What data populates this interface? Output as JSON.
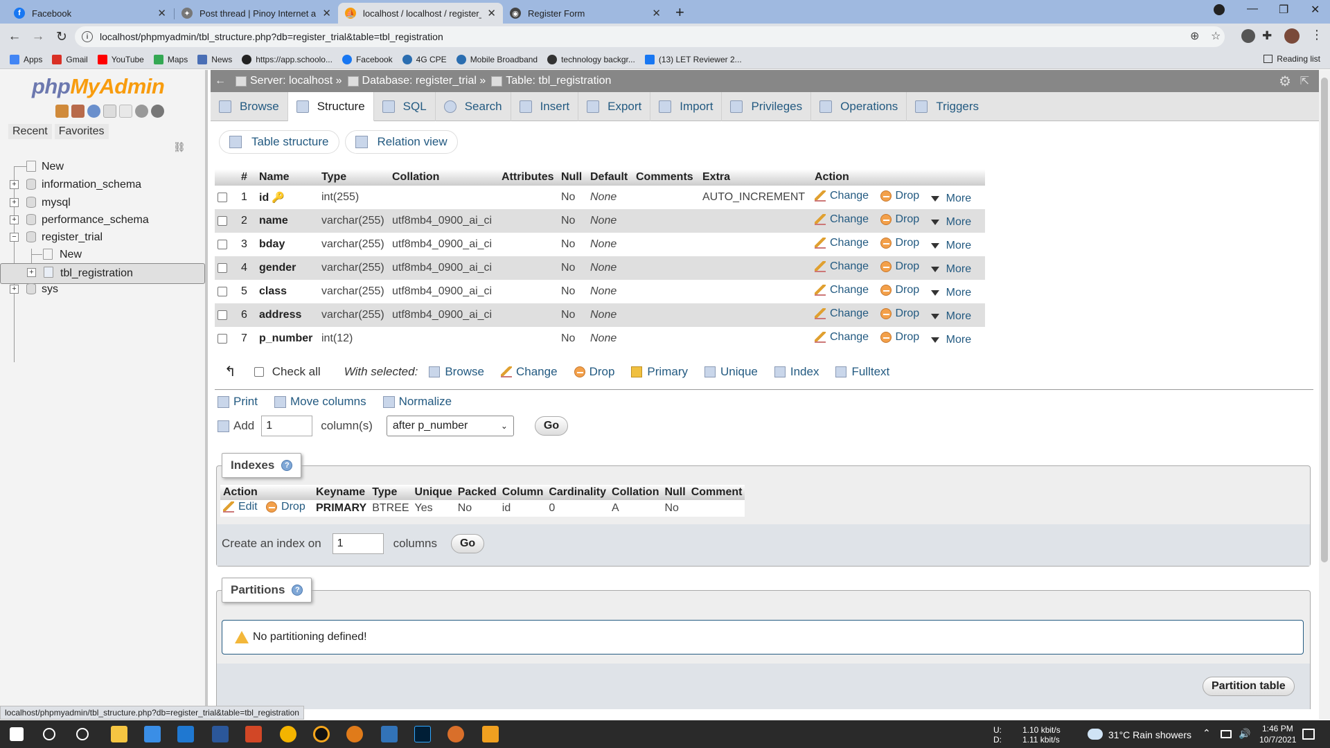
{
  "browser": {
    "tabs": [
      {
        "title": "Facebook",
        "color": "#1877f2",
        "glyph": "f"
      },
      {
        "title": "Post thread | Pinoy Internet and",
        "color": "#6a6a6a",
        "glyph": "✦"
      },
      {
        "title": "localhost / localhost / register_tr",
        "color": "#f89c0e",
        "glyph": "⛵"
      },
      {
        "title": "Register Form",
        "color": "#444444",
        "glyph": "◉"
      }
    ],
    "url": "localhost/phpmyadmin/tbl_structure.php?db=register_trial&table=tbl_registration",
    "bookmarks": [
      {
        "label": "Apps",
        "color": "#4285f4"
      },
      {
        "label": "Gmail",
        "color": "#d93025"
      },
      {
        "label": "YouTube",
        "color": "#ff0000"
      },
      {
        "label": "Maps",
        "color": "#34a853"
      },
      {
        "label": "News",
        "color": "#4a6fb5"
      },
      {
        "label": "https://app.schoolo...",
        "color": "#222222"
      },
      {
        "label": "Facebook",
        "color": "#1877f2"
      },
      {
        "label": "4G CPE",
        "color": "#2a6db0"
      },
      {
        "label": "Mobile Broadband",
        "color": "#2a6db0"
      },
      {
        "label": "technology backgr...",
        "color": "#333333"
      },
      {
        "label": "(13) LET Reviewer 2...",
        "color": "#1877f2"
      }
    ],
    "reading_list": "Reading list",
    "status_url": "localhost/phpmyadmin/tbl_structure.php?db=register_trial&table=tbl_registration"
  },
  "nav": {
    "logo_php": "php",
    "logo_my": "MyAdmin",
    "tabs": [
      "Recent",
      "Favorites"
    ],
    "tree": {
      "new": "New",
      "information_schema": "information_schema",
      "mysql": "mysql",
      "performance_schema": "performance_schema",
      "register_trial": "register_trial",
      "register_new": "New",
      "tbl_registration": "tbl_registration",
      "sys": "sys"
    }
  },
  "breadcrumb": {
    "server": "Server: localhost »",
    "database": "Database: register_trial »",
    "table": "Table: tbl_registration"
  },
  "menu": [
    "Browse",
    "Structure",
    "SQL",
    "Search",
    "Insert",
    "Export",
    "Import",
    "Privileges",
    "Operations",
    "Triggers"
  ],
  "subtabs": [
    "Table structure",
    "Relation view"
  ],
  "structure": {
    "headers": [
      "#",
      "Name",
      "Type",
      "Collation",
      "Attributes",
      "Null",
      "Default",
      "Comments",
      "Extra",
      "Action"
    ],
    "rows": [
      {
        "num": "1",
        "name": "id",
        "type": "int(255)",
        "collation": "",
        "null": "No",
        "default": "None",
        "extra": "AUTO_INCREMENT"
      },
      {
        "num": "2",
        "name": "name",
        "type": "varchar(255)",
        "collation": "utf8mb4_0900_ai_ci",
        "null": "No",
        "default": "None",
        "extra": ""
      },
      {
        "num": "3",
        "name": "bday",
        "type": "varchar(255)",
        "collation": "utf8mb4_0900_ai_ci",
        "null": "No",
        "default": "None",
        "extra": ""
      },
      {
        "num": "4",
        "name": "gender",
        "type": "varchar(255)",
        "collation": "utf8mb4_0900_ai_ci",
        "null": "No",
        "default": "None",
        "extra": ""
      },
      {
        "num": "5",
        "name": "class",
        "type": "varchar(255)",
        "collation": "utf8mb4_0900_ai_ci",
        "null": "No",
        "default": "None",
        "extra": ""
      },
      {
        "num": "6",
        "name": "address",
        "type": "varchar(255)",
        "collation": "utf8mb4_0900_ai_ci",
        "null": "No",
        "default": "None",
        "extra": ""
      },
      {
        "num": "7",
        "name": "p_number",
        "type": "int(12)",
        "collation": "",
        "null": "No",
        "default": "None",
        "extra": ""
      }
    ],
    "actions": [
      "Change",
      "Drop",
      "More"
    ]
  },
  "with_selected": {
    "check_all": "Check all",
    "label": "With selected:",
    "actions": [
      "Browse",
      "Change",
      "Drop",
      "Primary",
      "Unique",
      "Index",
      "Fulltext"
    ]
  },
  "tools": {
    "print": "Print",
    "move_columns": "Move columns",
    "normalize": "Normalize",
    "add": "Add",
    "add_count": "1",
    "columns_label": "column(s)",
    "position": "after p_number",
    "go": "Go"
  },
  "indexes": {
    "legend": "Indexes",
    "headers": [
      "Action",
      "Keyname",
      "Type",
      "Unique",
      "Packed",
      "Column",
      "Cardinality",
      "Collation",
      "Null",
      "Comment"
    ],
    "row": {
      "edit": "Edit",
      "drop": "Drop",
      "keyname": "PRIMARY",
      "type": "BTREE",
      "unique": "Yes",
      "packed": "No",
      "column": "id",
      "cardinality": "0",
      "collation": "A",
      "null": "No",
      "comment": ""
    },
    "create_label": "Create an index on",
    "create_count": "1",
    "columns_label": "columns",
    "go": "Go"
  },
  "partitions": {
    "legend": "Partitions",
    "message": "No partitioning defined!",
    "button": "Partition table"
  },
  "taskbar": {
    "net_up_label": "U:",
    "net_down_label": "D:",
    "net_up": "1.10 kbit/s",
    "net_down": "1.11 kbit/s",
    "weather": "31°C  Rain showers",
    "time": "1:46 PM",
    "date": "10/7/2021"
  }
}
